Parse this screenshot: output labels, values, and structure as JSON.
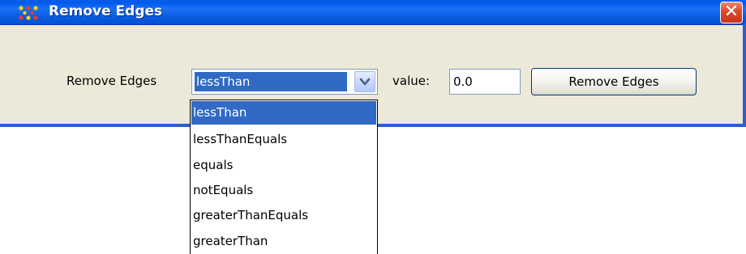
{
  "window": {
    "title": "Remove Edges",
    "close_glyph": "✕",
    "icon": "network-grid-icon"
  },
  "form": {
    "label": "Remove Edges",
    "operator_selected": "lessThan",
    "value_label": "value:",
    "value": "0.0",
    "submit_label": "Remove Edges"
  },
  "dropdown": {
    "options": [
      "lessThan",
      "lessThanEquals",
      "equals",
      "notEquals",
      "greaterThanEquals",
      "greaterThan"
    ],
    "selected_index": 0
  },
  "colors": {
    "titlebar": "#0058ee",
    "selection": "#316ac5",
    "close_button": "#d9492a",
    "dialog_background": "#ece9d8"
  }
}
